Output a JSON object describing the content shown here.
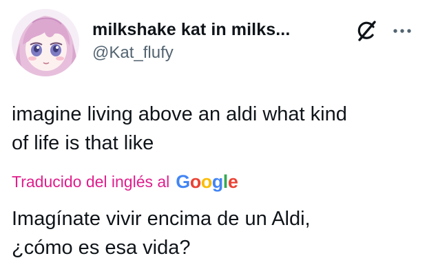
{
  "author": {
    "display_name": "milkshake kat in milks...",
    "handle": "@Kat_flufy",
    "avatar_icon": "anime-girl-avatar"
  },
  "actions": {
    "grok_icon": "grok-slash-circle-icon",
    "more_icon": "more-dots-icon"
  },
  "tweet": {
    "text_line1": "imagine living above an aldi what kind",
    "text_line2": "of life is that like"
  },
  "translation": {
    "translated_by": "Traducido del inglés al",
    "provider_letters": [
      "G",
      "o",
      "o",
      "g",
      "l",
      "e"
    ],
    "text_line1": "Imagínate vivir encima de un Aldi,",
    "text_line2": "¿cómo es esa vida?"
  },
  "colors": {
    "text": "#0f1419",
    "secondary": "#536471",
    "translate_label": "#e01e8c",
    "google_blue": "#4285f4",
    "google_red": "#ea4335",
    "google_yellow": "#fbbc05",
    "google_green": "#34a853"
  }
}
